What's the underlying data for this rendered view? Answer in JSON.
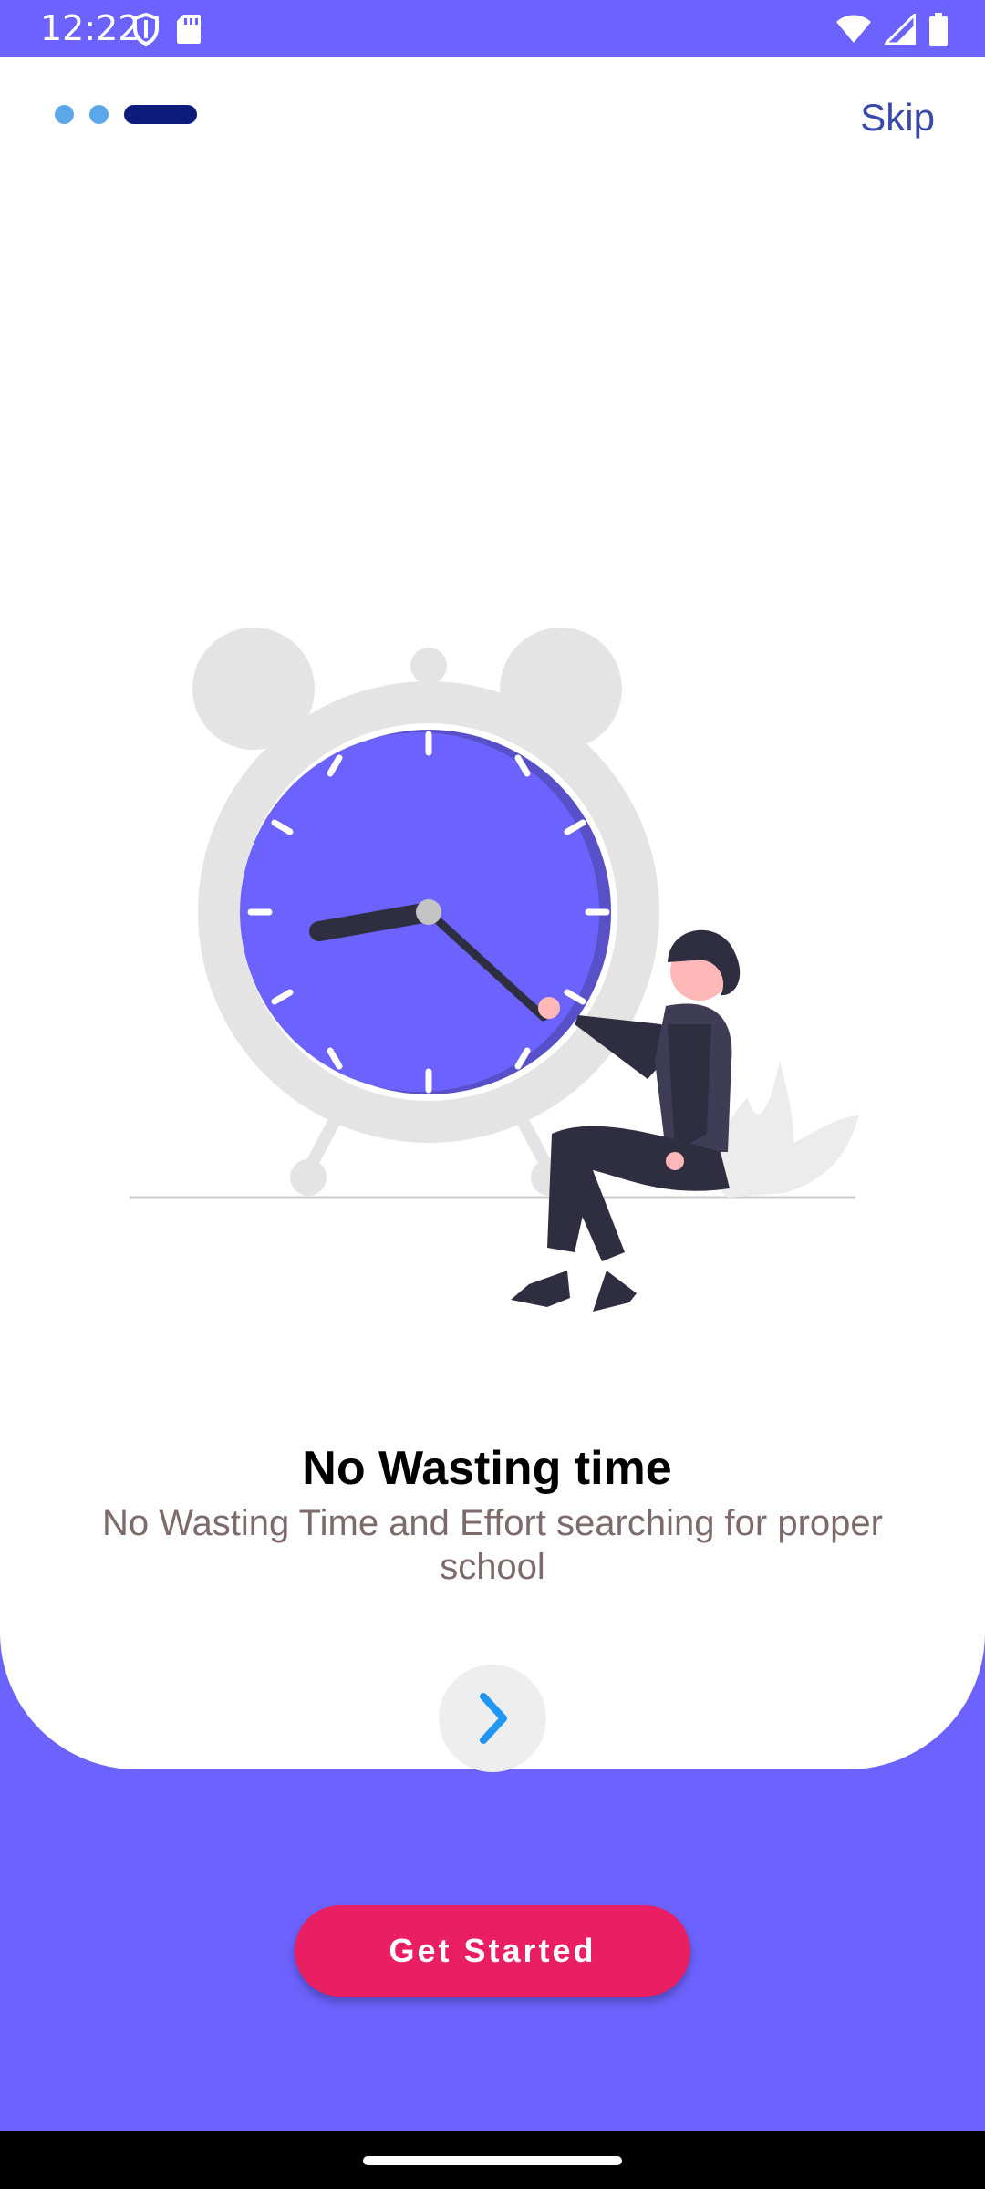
{
  "status_bar": {
    "time": "12:22",
    "icons": [
      "shield-icon",
      "sd-card-icon",
      "wifi-icon",
      "cellular-signal-icon",
      "battery-icon"
    ]
  },
  "onboarding": {
    "skip_label": "Skip",
    "page_indicator": {
      "total_pages": 3,
      "active_page": 3
    },
    "illustration": "alarm-clock-with-woman-illustration",
    "title": "No Wasting time",
    "subtitle": "No Wasting Time and Effort searching for proper school",
    "next_icon": "chevron-right-icon"
  },
  "cta": {
    "get_started_label": "Get Started"
  },
  "colors": {
    "background": "#6c63ff",
    "card": "#ffffff",
    "indicator_dot": "#5aa7ea",
    "indicator_active": "#0d1b7d",
    "skip_text": "#3949ab",
    "subtitle_text": "#7d6b6b",
    "cta_button": "#e91e63",
    "next_chevron": "#2196f3"
  }
}
